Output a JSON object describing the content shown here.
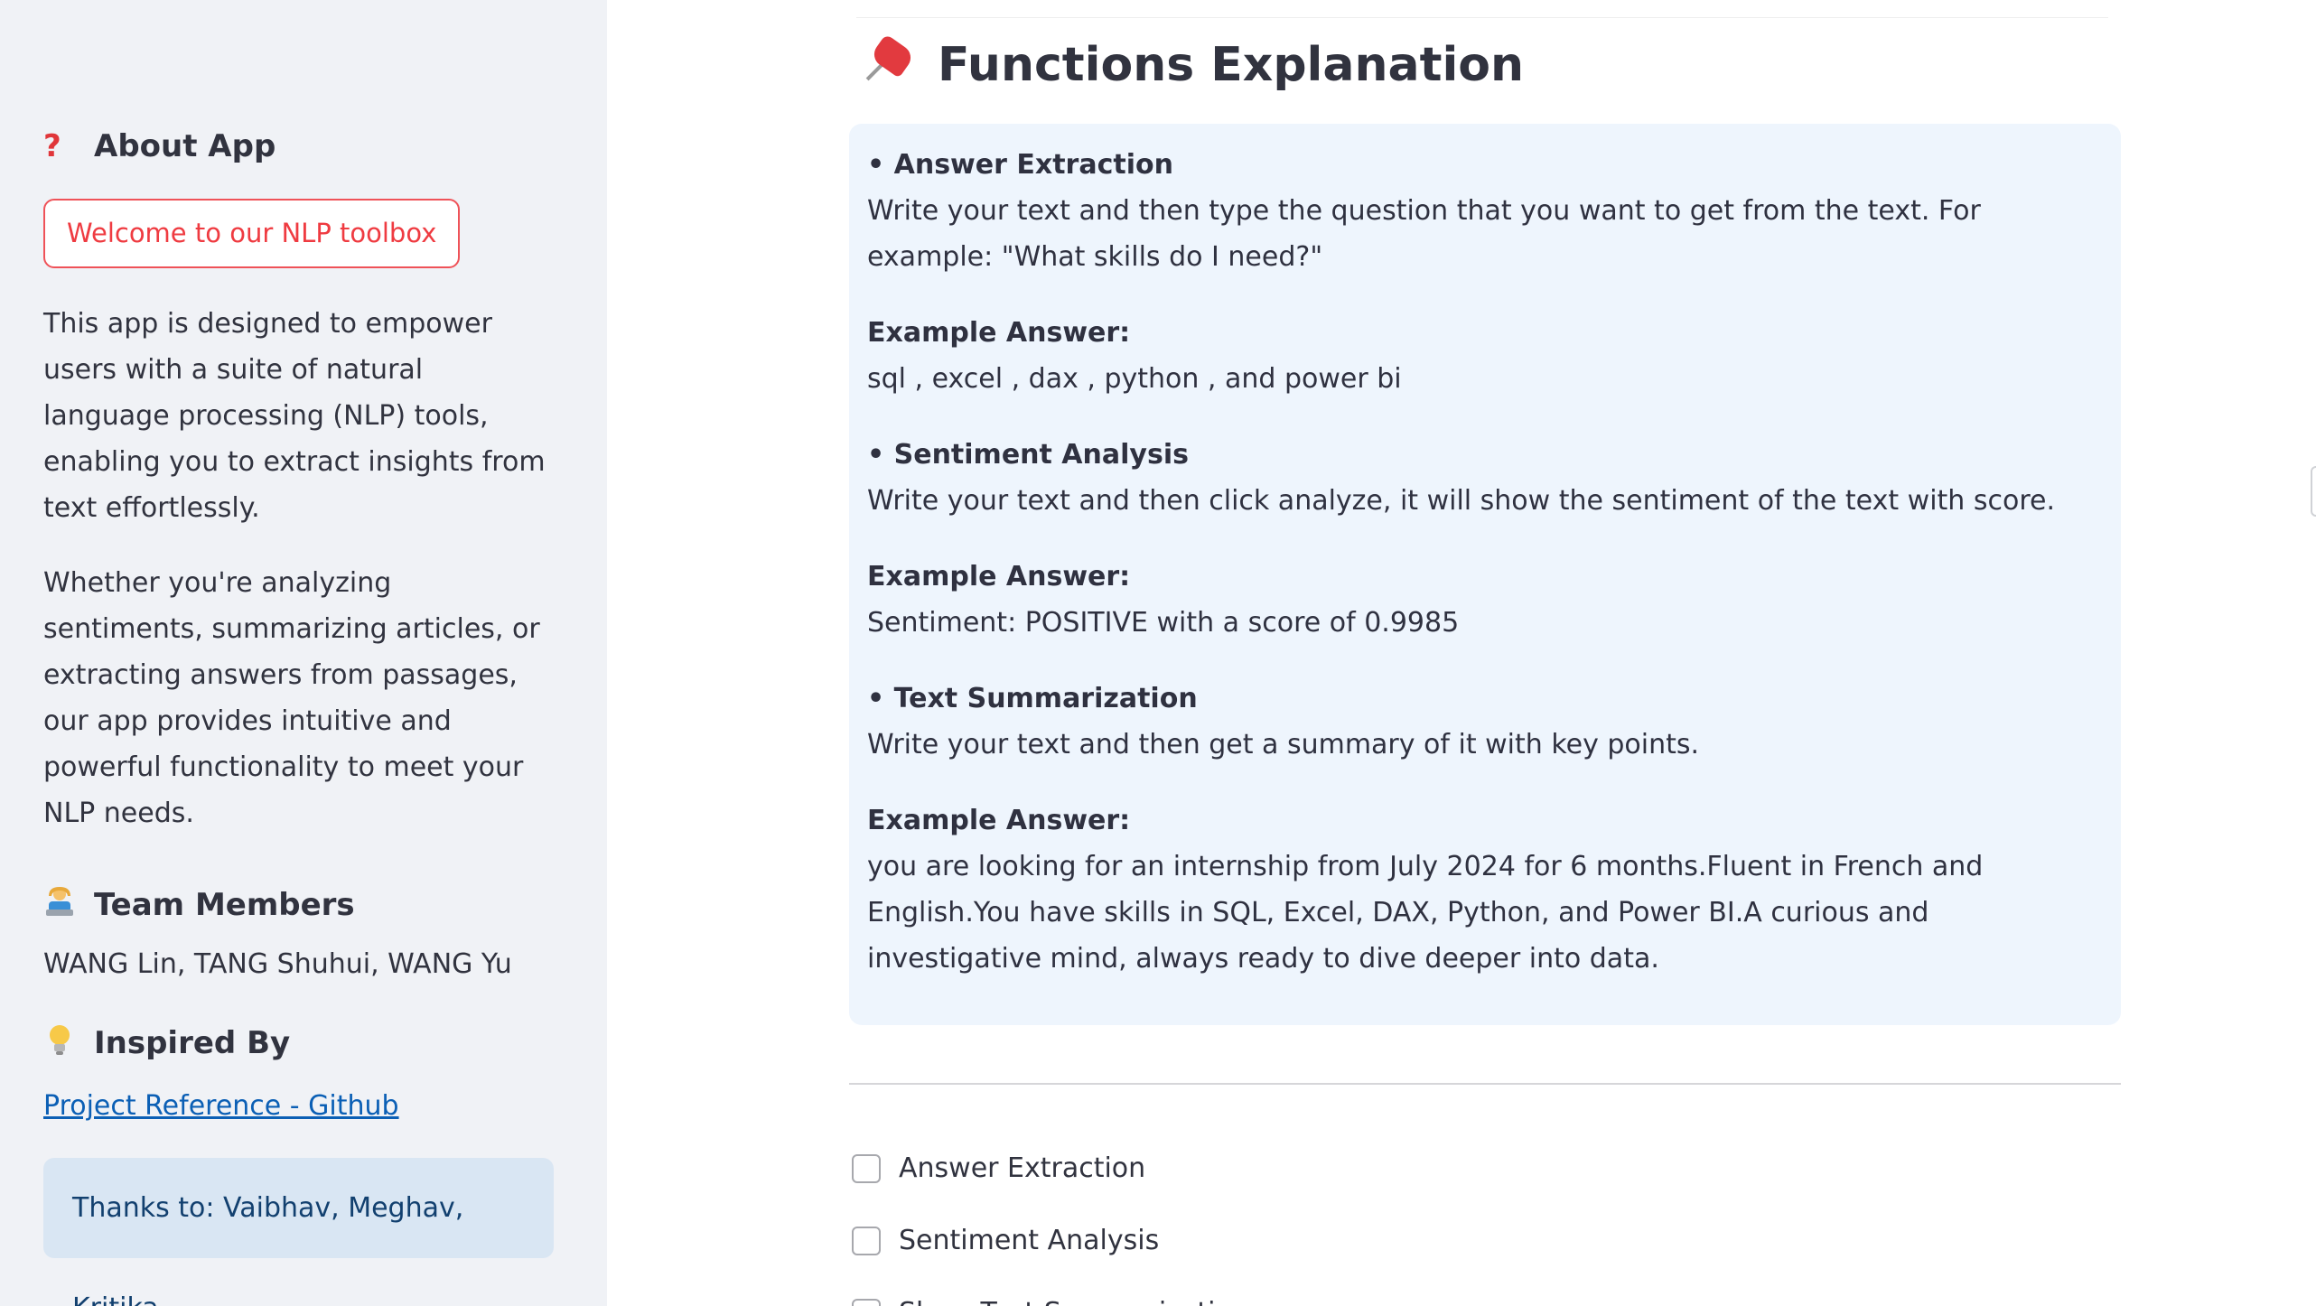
{
  "sidebar": {
    "about_heading": "About App",
    "about_icon": "red-question-mark-icon",
    "welcome_button": "Welcome to our NLP toolbox",
    "desc_1": "This app is designed to empower users with a suite of natural language processing (NLP) tools, enabling you to extract insights from text effortlessly.",
    "desc_2": "Whether you're analyzing sentiments, summarizing articles, or extracting answers from passages, our app provides intuitive and powerful functionality to meet your NLP needs.",
    "team_heading": "Team Members",
    "team_icon": "person-at-laptop-icon",
    "team_members": "WANG Lin, TANG Shuhui, WANG Yu",
    "inspired_heading": "Inspired By",
    "inspired_icon": "light-bulb-icon",
    "github_link": "Project Reference - Github",
    "thanks": "Thanks to: Vaibhav, Meghav, Kritika"
  },
  "main": {
    "title": "Functions Explanation",
    "title_icon": "pushpin-icon",
    "sections": [
      {
        "heading": "• Answer Extraction",
        "description": "Write your text and then type the question that you want to get from the text. For example: \"What skills do I need?\"",
        "example_label": "Example Answer:",
        "example": "sql , excel , dax , python , and power bi"
      },
      {
        "heading": "• Sentiment Analysis",
        "description": "Write your text and then click analyze, it will show the sentiment of the text with score.",
        "example_label": "Example Answer:",
        "example": "Sentiment: POSITIVE with a score of 0.9985"
      },
      {
        "heading": "• Text Summarization",
        "description": "Write your text and then get a summary of it with key points.",
        "example_label": "Example Answer:",
        "example": "you are looking for an internship from July 2024 for 6 months.Fluent in French and English.You have skills in SQL, Excel, DAX, Python, and Power BI.A curious and investigative mind, always ready to dive deeper into data."
      }
    ],
    "checkboxes": [
      {
        "label": "Answer Extraction",
        "checked": false
      },
      {
        "label": "Sentiment Analysis",
        "checked": false
      },
      {
        "label": "Show Text Summarization",
        "checked": false
      }
    ]
  },
  "colors": {
    "sidebar_bg": "#f0f2f6",
    "accent_red": "#ef3b41",
    "info_box_bg": "#eef5fd",
    "link_blue": "#0b5fb5",
    "thanks_bg": "#d9e6f3",
    "thanks_text": "#12406f"
  }
}
